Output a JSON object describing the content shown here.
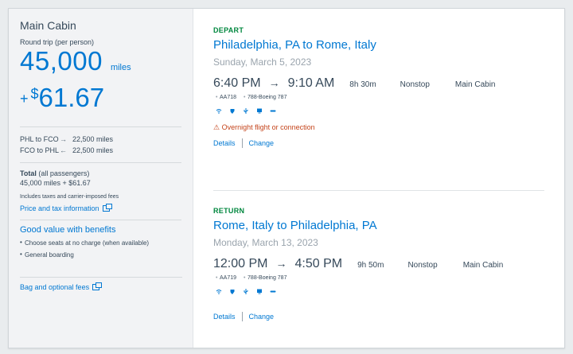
{
  "summary": {
    "cabin_title": "Main Cabin",
    "round_trip_label": "Round trip (per person)",
    "miles": "45,000",
    "miles_word": "miles",
    "plus": "+",
    "dollar_sign": "$",
    "amount": "61.67",
    "segments": [
      {
        "route": "PHL to FCO",
        "arrow": "→",
        "miles": "22,500 miles"
      },
      {
        "route": "FCO to PHL",
        "arrow": "←",
        "miles": "22,500 miles"
      }
    ],
    "total_label": "Total",
    "total_suffix": " (all passengers)",
    "total_value": "45,000 miles + $61.67",
    "fees_note": "Includes taxes and carrier-imposed fees",
    "price_link": "Price and tax information",
    "benefits_title": "Good value with benefits",
    "benefits": [
      "Choose seats at no charge (when available)",
      "General boarding"
    ],
    "bag_link": "Bag and optional fees"
  },
  "depart": {
    "label": "DEPART",
    "route": "Philadelphia, PA to Rome, Italy",
    "date": "Sunday, March 5, 2023",
    "depart_time": "6:40 PM",
    "arrow": "→",
    "arrive_time": "9:10 AM",
    "duration": "8h 30m",
    "stops": "Nonstop",
    "cabin": "Main Cabin",
    "flight_number": "AA718",
    "aircraft": "788-Boeing 787",
    "warning": "⚠ Overnight flight or connection",
    "details_link": "Details",
    "change_link": "Change"
  },
  "return": {
    "label": "RETURN",
    "route": "Rome, Italy to Philadelphia, PA",
    "date": "Monday, March 13, 2023",
    "depart_time": "12:00 PM",
    "arrow": "→",
    "arrive_time": "4:50 PM",
    "duration": "9h 50m",
    "stops": "Nonstop",
    "cabin": "Main Cabin",
    "flight_number": "AA719",
    "aircraft": "788-Boeing 787",
    "details_link": "Details",
    "change_link": "Change"
  },
  "amenity_icons": [
    "wifi-icon",
    "shield-icon",
    "usb-power-icon",
    "entertainment-icon",
    "food-icon"
  ],
  "colors": {
    "accent": "#0078d2",
    "label_green": "#00873e",
    "warning": "#c4431a"
  }
}
